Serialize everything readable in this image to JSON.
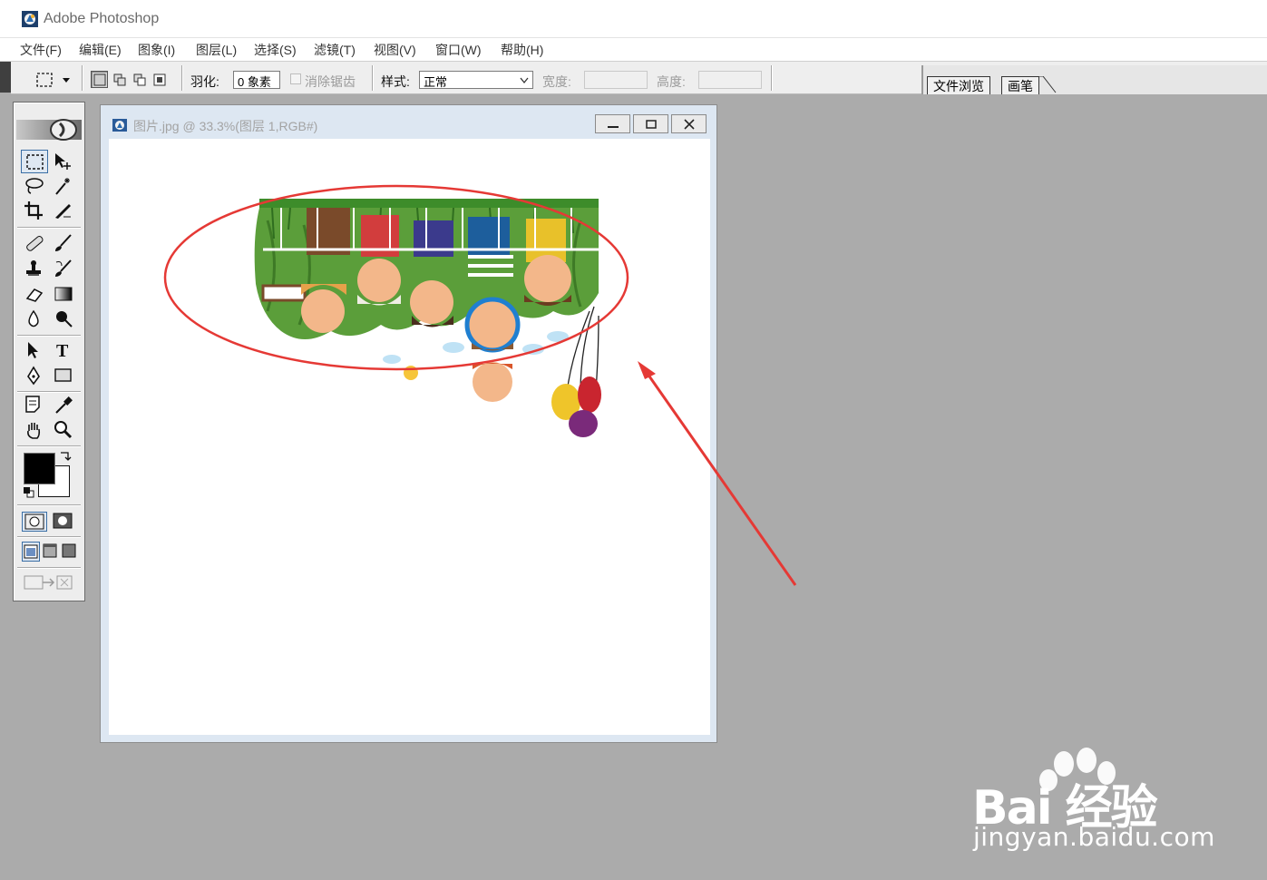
{
  "app": {
    "title": "Adobe Photoshop"
  },
  "menu": {
    "items": [
      "文件(F)",
      "编辑(E)",
      "图象(I)",
      "图层(L)",
      "选择(S)",
      "滤镜(T)",
      "视图(V)",
      "窗口(W)",
      "帮助(H)"
    ]
  },
  "options": {
    "feather_label": "羽化:",
    "feather_value": "0 象素",
    "antialias_label": "消除锯齿",
    "style_label": "样式:",
    "style_value": "正常",
    "width_label": "宽度:",
    "height_label": "高度:"
  },
  "palette_well": {
    "tabs": [
      "文件浏览",
      "画笔"
    ]
  },
  "toolbox": {
    "tools": [
      "rectangular-marquee",
      "move",
      "lasso",
      "magic-wand",
      "crop",
      "slice",
      "healing-brush",
      "brush",
      "clone-stamp",
      "history-brush",
      "eraser",
      "gradient",
      "blur",
      "dodge",
      "path-selection",
      "type",
      "pen",
      "rectangle",
      "notes",
      "eyedropper",
      "hand",
      "zoom"
    ],
    "foreground_color": "#000000",
    "background_color": "#ffffff"
  },
  "document": {
    "title": "图片.jpg @ 33.3%(图层 1,RGB#)"
  },
  "annotation": {
    "ellipse_color": "#e53935",
    "arrow_color": "#e53935"
  },
  "watermark": {
    "brand": "Bai 经验",
    "url": "jingyan.baidu.com"
  }
}
